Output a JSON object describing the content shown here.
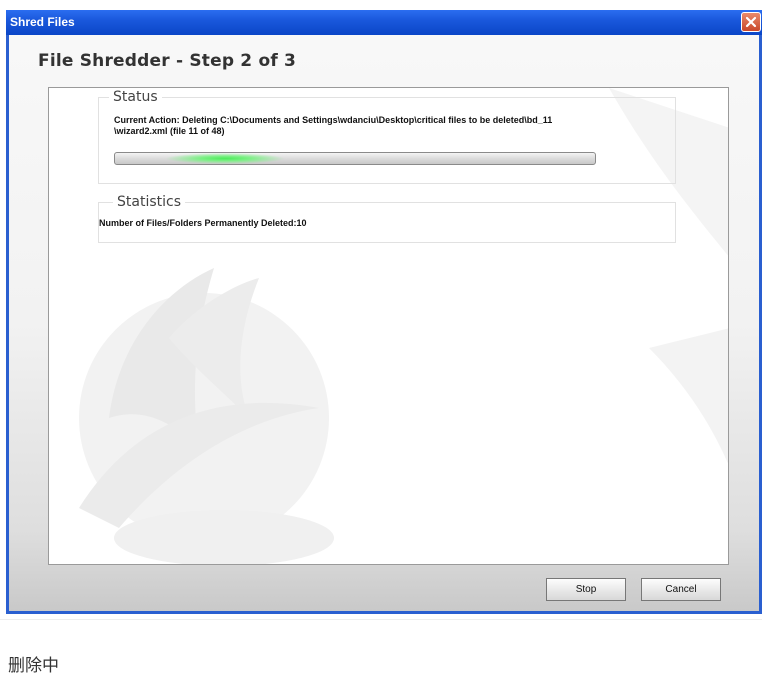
{
  "window": {
    "title": "Shred Files"
  },
  "wizard": {
    "heading": "File Shredder - Step 2 of 3"
  },
  "status": {
    "group_title": "Status",
    "action_line1": "Current Action:  Deleting C:\\Documents and Settings\\wdanciu\\Desktop\\critical files to be deleted\\bd_11",
    "action_line2": "\\wizard2.xml  (file 11 of 48)",
    "progress": 0.229
  },
  "statistics": {
    "group_title": "Statistics",
    "deleted_line": "Number of Files/Folders Permanently Deleted:10"
  },
  "buttons": {
    "stop": "Stop",
    "cancel": "Cancel"
  },
  "caption": "删除中",
  "icons": {
    "close": "close-icon",
    "watermark": "logo-watermark"
  },
  "colors": {
    "titlebar": "#1a58dc",
    "close": "#c9472a",
    "progress_glow": "#4dea5a"
  }
}
